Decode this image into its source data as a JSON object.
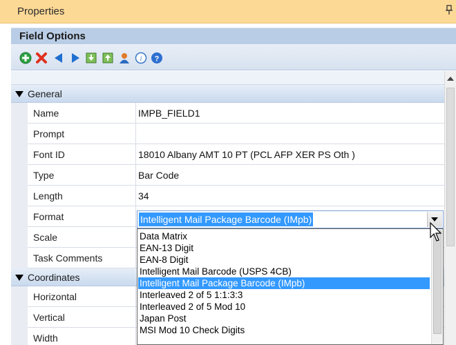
{
  "panel": {
    "title": "Properties"
  },
  "subheader": {
    "label": "Field Options"
  },
  "toolbar": {
    "icons": [
      "add-icon",
      "delete-icon",
      "previous-icon",
      "next-icon",
      "import-icon",
      "export-icon",
      "user-icon",
      "info-icon",
      "help-icon"
    ]
  },
  "categories": {
    "general": "General",
    "coordinates": "Coordinates"
  },
  "general_rows": [
    {
      "name": "Name",
      "value": "IMPB_FIELD1"
    },
    {
      "name": "Prompt",
      "value": ""
    },
    {
      "name": "Font ID",
      "value": "18010 Albany AMT 10 PT (PCL AFP XER PS Oth )"
    },
    {
      "name": "Type",
      "value": "Bar Code"
    },
    {
      "name": "Length",
      "value": "34"
    },
    {
      "name": "Format",
      "value": ""
    },
    {
      "name": "Scale",
      "value": ""
    },
    {
      "name": "Task Comments",
      "value": ""
    }
  ],
  "coordinate_rows": [
    {
      "name": "Horizontal",
      "value": ""
    },
    {
      "name": "Vertical",
      "value": ""
    },
    {
      "name": "Width",
      "value": ""
    }
  ],
  "format_combo": {
    "selected": "Intelligent Mail Package Barcode (IMpb)"
  },
  "format_options": [
    "Data Matrix",
    "EAN-13 Digit",
    "EAN-8 Digit",
    "Intelligent Mail Barcode (USPS 4CB)",
    "Intelligent Mail Package Barcode (IMpb)",
    "Interleaved 2 of 5 1:1:3:3",
    "Interleaved 2 of 5 Mod 10",
    "Japan Post",
    "MSI Mod 10 Check Digits"
  ],
  "colors": {
    "title_bar": "#fdd996",
    "subheader": "#b9cde6",
    "selection": "#3399ff"
  }
}
